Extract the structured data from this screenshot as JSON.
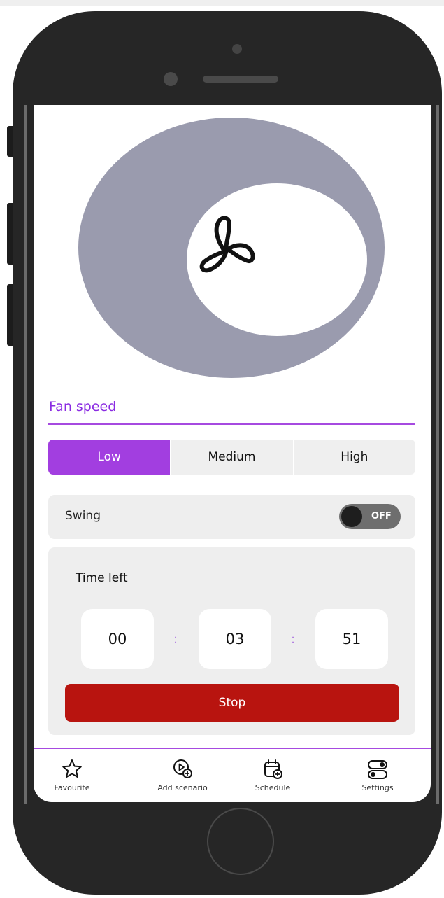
{
  "fan": {
    "icon": "fan-icon",
    "speed_label": "Fan speed",
    "speeds": [
      {
        "label": "Low",
        "active": true
      },
      {
        "label": "Medium",
        "active": false
      },
      {
        "label": "High",
        "active": false
      }
    ]
  },
  "swing": {
    "label": "Swing",
    "toggle_text": "OFF",
    "on": false
  },
  "timer": {
    "title": "Time left",
    "hours": "00",
    "minutes": "03",
    "seconds": "51",
    "separator": ":",
    "stop_label": "Stop"
  },
  "nav": [
    {
      "label": "Favourite",
      "icon": "star-icon"
    },
    {
      "label": "Add scenario",
      "icon": "add-scenario-icon"
    },
    {
      "label": "Schedule",
      "icon": "calendar-add-icon"
    },
    {
      "label": "Settings",
      "icon": "settings-toggle-icon"
    }
  ],
  "colors": {
    "accent": "#a23ee0",
    "stop": "#b8140f",
    "ring": "#9a9bae"
  }
}
